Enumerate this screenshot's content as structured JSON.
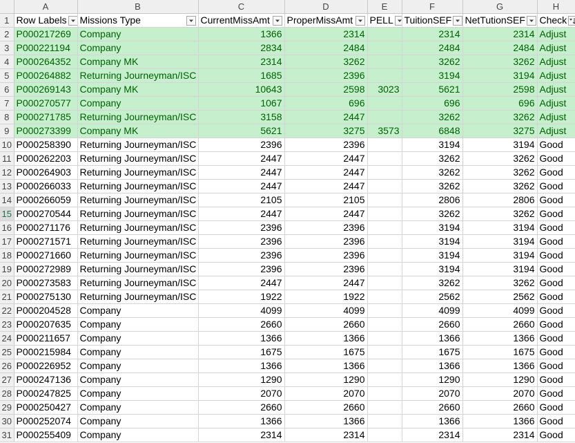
{
  "column_letters": [
    "A",
    "B",
    "C",
    "D",
    "E",
    "F",
    "G",
    "H"
  ],
  "headers": [
    "Row Labels",
    "Missions Type",
    "CurrentMissAmt",
    "ProperMissAmt",
    "PELL",
    "TuitionSEF",
    "NetTutionSEF",
    "Check"
  ],
  "filter_icons": [
    "filter-dropdown-icon",
    "filter-dropdown-icon",
    "filter-dropdown-icon",
    "filter-dropdown-icon",
    "filter-dropdown-icon",
    "filter-dropdown-icon",
    "filter-dropdown-icon",
    "filter-sorted-icon"
  ],
  "selected_row": "15",
  "highlight_colors": {
    "fill": "#c6efce",
    "text": "#006100"
  },
  "rows": [
    {
      "n": "2",
      "highlight": true,
      "c": [
        "P000217269",
        "Company",
        "1366",
        "2314",
        "",
        "2314",
        "2314",
        "Adjust"
      ]
    },
    {
      "n": "3",
      "highlight": true,
      "c": [
        "P000221194",
        "Company",
        "2834",
        "2484",
        "",
        "2484",
        "2484",
        "Adjust"
      ]
    },
    {
      "n": "4",
      "highlight": true,
      "c": [
        "P000264352",
        "Company MK",
        "2314",
        "3262",
        "",
        "3262",
        "3262",
        "Adjust"
      ]
    },
    {
      "n": "5",
      "highlight": true,
      "c": [
        "P000264882",
        "Returning Journeyman/ISC",
        "1685",
        "2396",
        "",
        "3194",
        "3194",
        "Adjust"
      ]
    },
    {
      "n": "6",
      "highlight": true,
      "c": [
        "P000269143",
        "Company MK",
        "10643",
        "2598",
        "3023",
        "5621",
        "2598",
        "Adjust"
      ]
    },
    {
      "n": "7",
      "highlight": true,
      "c": [
        "P000270577",
        "Company",
        "1067",
        "696",
        "",
        "696",
        "696",
        "Adjust"
      ]
    },
    {
      "n": "8",
      "highlight": true,
      "c": [
        "P000271785",
        "Returning Journeyman/ISC",
        "3158",
        "2447",
        "",
        "3262",
        "3262",
        "Adjust"
      ]
    },
    {
      "n": "9",
      "highlight": true,
      "c": [
        "P000273399",
        "Company MK",
        "5621",
        "3275",
        "3573",
        "6848",
        "3275",
        "Adjust"
      ]
    },
    {
      "n": "10",
      "highlight": false,
      "c": [
        "P000258390",
        "Returning Journeyman/ISC",
        "2396",
        "2396",
        "",
        "3194",
        "3194",
        "Good"
      ]
    },
    {
      "n": "11",
      "highlight": false,
      "c": [
        "P000262203",
        "Returning Journeyman/ISC",
        "2447",
        "2447",
        "",
        "3262",
        "3262",
        "Good"
      ]
    },
    {
      "n": "12",
      "highlight": false,
      "c": [
        "P000264903",
        "Returning Journeyman/ISC",
        "2447",
        "2447",
        "",
        "3262",
        "3262",
        "Good"
      ]
    },
    {
      "n": "13",
      "highlight": false,
      "c": [
        "P000266033",
        "Returning Journeyman/ISC",
        "2447",
        "2447",
        "",
        "3262",
        "3262",
        "Good"
      ]
    },
    {
      "n": "14",
      "highlight": false,
      "c": [
        "P000266059",
        "Returning Journeyman/ISC",
        "2105",
        "2105",
        "",
        "2806",
        "2806",
        "Good"
      ]
    },
    {
      "n": "15",
      "highlight": false,
      "c": [
        "P000270544",
        "Returning Journeyman/ISC",
        "2447",
        "2447",
        "",
        "3262",
        "3262",
        "Good"
      ]
    },
    {
      "n": "16",
      "highlight": false,
      "c": [
        "P000271176",
        "Returning Journeyman/ISC",
        "2396",
        "2396",
        "",
        "3194",
        "3194",
        "Good"
      ]
    },
    {
      "n": "17",
      "highlight": false,
      "c": [
        "P000271571",
        "Returning Journeyman/ISC",
        "2396",
        "2396",
        "",
        "3194",
        "3194",
        "Good"
      ]
    },
    {
      "n": "18",
      "highlight": false,
      "c": [
        "P000271660",
        "Returning Journeyman/ISC",
        "2396",
        "2396",
        "",
        "3194",
        "3194",
        "Good"
      ]
    },
    {
      "n": "19",
      "highlight": false,
      "c": [
        "P000272989",
        "Returning Journeyman/ISC",
        "2396",
        "2396",
        "",
        "3194",
        "3194",
        "Good"
      ]
    },
    {
      "n": "20",
      "highlight": false,
      "c": [
        "P000273583",
        "Returning Journeyman/ISC",
        "2447",
        "2447",
        "",
        "3262",
        "3262",
        "Good"
      ]
    },
    {
      "n": "21",
      "highlight": false,
      "c": [
        "P000275130",
        "Returning Journeyman/ISC",
        "1922",
        "1922",
        "",
        "2562",
        "2562",
        "Good"
      ]
    },
    {
      "n": "22",
      "highlight": false,
      "c": [
        "P000204528",
        "Company",
        "4099",
        "4099",
        "",
        "4099",
        "4099",
        "Good"
      ]
    },
    {
      "n": "23",
      "highlight": false,
      "c": [
        "P000207635",
        "Company",
        "2660",
        "2660",
        "",
        "2660",
        "2660",
        "Good"
      ]
    },
    {
      "n": "24",
      "highlight": false,
      "c": [
        "P000211657",
        "Company",
        "1366",
        "1366",
        "",
        "1366",
        "1366",
        "Good"
      ]
    },
    {
      "n": "25",
      "highlight": false,
      "c": [
        "P000215984",
        "Company",
        "1675",
        "1675",
        "",
        "1675",
        "1675",
        "Good"
      ]
    },
    {
      "n": "26",
      "highlight": false,
      "c": [
        "P000226952",
        "Company",
        "1366",
        "1366",
        "",
        "1366",
        "1366",
        "Good"
      ]
    },
    {
      "n": "27",
      "highlight": false,
      "c": [
        "P000247136",
        "Company",
        "1290",
        "1290",
        "",
        "1290",
        "1290",
        "Good"
      ]
    },
    {
      "n": "28",
      "highlight": false,
      "c": [
        "P000247825",
        "Company",
        "2070",
        "2070",
        "",
        "2070",
        "2070",
        "Good"
      ]
    },
    {
      "n": "29",
      "highlight": false,
      "c": [
        "P000250427",
        "Company",
        "2660",
        "2660",
        "",
        "2660",
        "2660",
        "Good"
      ]
    },
    {
      "n": "30",
      "highlight": false,
      "c": [
        "P000252074",
        "Company",
        "1366",
        "1366",
        "",
        "1366",
        "1366",
        "Good"
      ]
    },
    {
      "n": "31",
      "highlight": false,
      "c": [
        "P000255409",
        "Company",
        "2314",
        "2314",
        "",
        "2314",
        "2314",
        "Good"
      ]
    }
  ]
}
